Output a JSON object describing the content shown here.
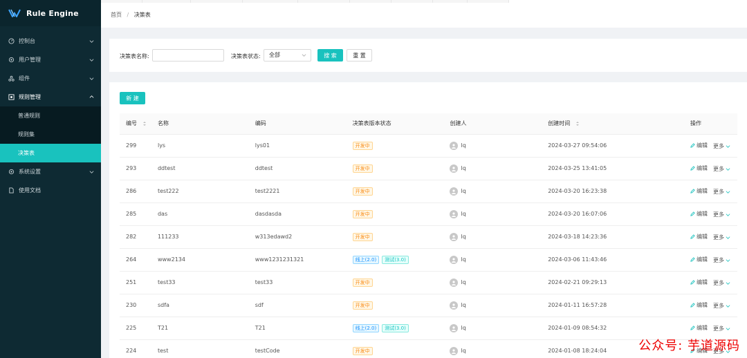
{
  "brand": {
    "title": "Rule Engine"
  },
  "sidebar": {
    "items": [
      {
        "label": "控制台"
      },
      {
        "label": "用户管理"
      },
      {
        "label": "组件"
      },
      {
        "label": "规则管理",
        "children": [
          {
            "label": "普通规则"
          },
          {
            "label": "规则集"
          },
          {
            "label": "决策表"
          }
        ]
      },
      {
        "label": "系统设置"
      },
      {
        "label": "使用文档"
      }
    ]
  },
  "breadcrumb": {
    "home": "首页",
    "separator": "/",
    "current": "决策表"
  },
  "search": {
    "name_label": "决策表名称:",
    "name_value": "",
    "status_label": "决策表状态:",
    "status_value": "全部",
    "search_button": "搜 索",
    "reset_button": "重 置"
  },
  "toolbar": {
    "new_button": "新 建"
  },
  "table": {
    "columns": {
      "id": "编号",
      "name": "名称",
      "code": "编码",
      "status": "决策表版本状态",
      "creator": "创建人",
      "created": "创建时间",
      "ops": "操作"
    },
    "edit_label": "编辑",
    "more_label": "更多",
    "rows": [
      {
        "id": "299",
        "name": "lys",
        "code": "lys01",
        "tags": [
          {
            "text": "开发中",
            "kind": "dev"
          }
        ],
        "creator": "lq",
        "created": "2024-03-27 09:54:06"
      },
      {
        "id": "293",
        "name": "ddtest",
        "code": "ddtest",
        "tags": [
          {
            "text": "开发中",
            "kind": "dev"
          }
        ],
        "creator": "lq",
        "created": "2024-03-25 13:41:05"
      },
      {
        "id": "286",
        "name": "test222",
        "code": "test2221",
        "tags": [
          {
            "text": "开发中",
            "kind": "dev"
          }
        ],
        "creator": "lq",
        "created": "2024-03-20 16:23:38"
      },
      {
        "id": "285",
        "name": "das",
        "code": "dasdasda",
        "tags": [
          {
            "text": "开发中",
            "kind": "dev"
          }
        ],
        "creator": "lq",
        "created": "2024-03-20 16:07:06"
      },
      {
        "id": "282",
        "name": "111233",
        "code": "w313edawd2",
        "tags": [
          {
            "text": "开发中",
            "kind": "dev"
          }
        ],
        "creator": "lq",
        "created": "2024-03-18 14:23:36"
      },
      {
        "id": "264",
        "name": "www2134",
        "code": "www1231231321",
        "tags": [
          {
            "text": "线上(2.0)",
            "kind": "online"
          },
          {
            "text": "测试(3.0)",
            "kind": "test"
          }
        ],
        "creator": "lq",
        "created": "2024-03-06 11:43:46"
      },
      {
        "id": "251",
        "name": "test33",
        "code": "test33",
        "tags": [
          {
            "text": "开发中",
            "kind": "dev"
          }
        ],
        "creator": "lq",
        "created": "2024-02-21 09:29:13"
      },
      {
        "id": "230",
        "name": "sdfa",
        "code": "sdf",
        "tags": [
          {
            "text": "开发中",
            "kind": "dev"
          }
        ],
        "creator": "lq",
        "created": "2024-01-11 16:57:28"
      },
      {
        "id": "225",
        "name": "T21",
        "code": "T21",
        "tags": [
          {
            "text": "线上(2.0)",
            "kind": "online"
          },
          {
            "text": "测试(3.0)",
            "kind": "test"
          }
        ],
        "creator": "lq",
        "created": "2024-01-09 08:54:32"
      },
      {
        "id": "224",
        "name": "test",
        "code": "testCode",
        "tags": [
          {
            "text": "开发中",
            "kind": "dev"
          }
        ],
        "creator": "lq",
        "created": "2024-01-08 18:24:04"
      }
    ]
  },
  "watermark": "公众号: 芋道源码",
  "colors": {
    "accent": "#19c2be",
    "sidebar": "#0e2a33"
  }
}
